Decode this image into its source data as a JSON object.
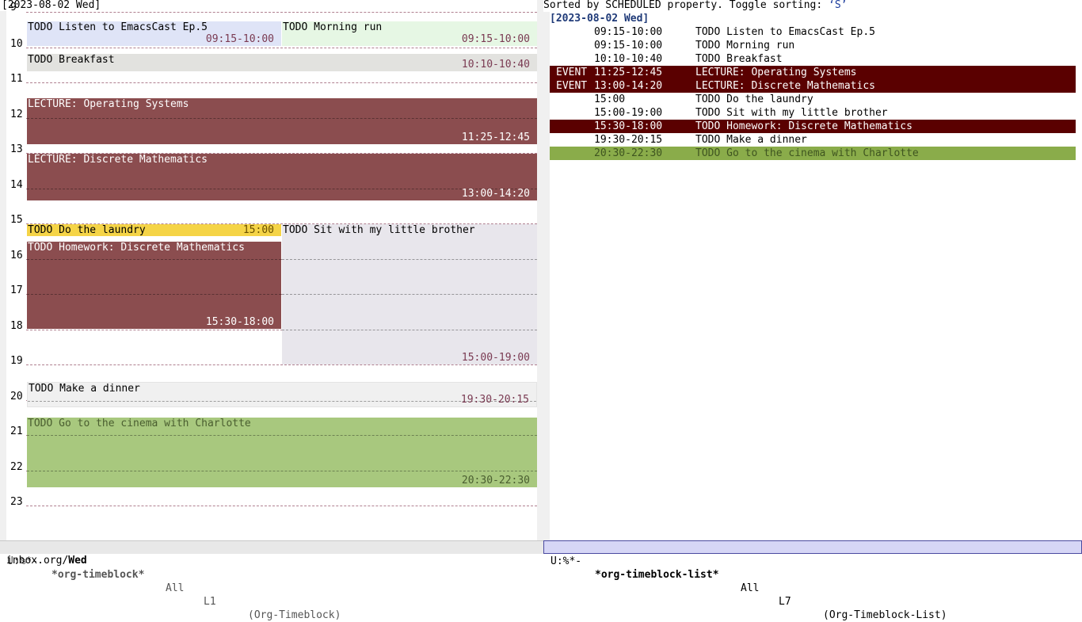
{
  "timeline": {
    "header_date": "[2023-08-02 Wed]",
    "hours": [
      "9",
      "10",
      "11",
      "12",
      "13",
      "14",
      "15",
      "16",
      "17",
      "18",
      "19",
      "20",
      "21",
      "22",
      "23"
    ],
    "blocks": [
      {
        "title": "TODO Listen to EmacsCast Ep.5",
        "time": "09:15-10:00"
      },
      {
        "title": "TODO Morning run",
        "time": "09:15-10:00"
      },
      {
        "title": "TODO Breakfast",
        "time": "10:10-10:40"
      },
      {
        "title": "LECTURE: Operating Systems",
        "time": "11:25-12:45"
      },
      {
        "title": "LECTURE: Discrete Mathematics",
        "time": "13:00-14:20"
      },
      {
        "title": "TODO Do the laundry",
        "time": "15:00"
      },
      {
        "title": "TODO Sit with my little brother",
        "time": "15:00-19:00"
      },
      {
        "title": "TODO Homework: Discrete Mathematics",
        "time": "15:30-18:00"
      },
      {
        "title": "TODO Make a dinner",
        "time": "19:30-20:15"
      },
      {
        "title": "TODO Go to the cinema with Charlotte",
        "time": "20:30-22:30"
      }
    ]
  },
  "list": {
    "header": "Sorted by SCHEDULED property. Toggle sorting: ",
    "sort_key": "‘S’",
    "date": "[2023-08-02 Wed]",
    "rows": [
      {
        "tag": "",
        "time": "09:15-10:00",
        "text": "TODO Listen to EmacsCast Ep.5"
      },
      {
        "tag": "",
        "time": "09:15-10:00",
        "text": "TODO Morning run"
      },
      {
        "tag": "",
        "time": "10:10-10:40",
        "text": "TODO Breakfast"
      },
      {
        "tag": "EVENT",
        "time": "11:25-12:45",
        "text": "LECTURE: Operating Systems"
      },
      {
        "tag": "EVENT",
        "time": "13:00-14:20",
        "text": "LECTURE: Discrete Mathematics"
      },
      {
        "tag": "",
        "time": "15:00",
        "text": "TODO Do the laundry"
      },
      {
        "tag": "",
        "time": "15:00-19:00",
        "text": "TODO Sit with my little brother"
      },
      {
        "tag": "",
        "time": "15:30-18:00",
        "text": "TODO Homework: Discrete Mathematics"
      },
      {
        "tag": "",
        "time": "19:30-20:15",
        "text": "TODO Make a dinner"
      },
      {
        "tag": "",
        "time": "20:30-22:30",
        "text": "TODO Go to the cinema with Charlotte"
      }
    ]
  },
  "modeline_left": {
    "status": "U:%*-",
    "buffer": "*org-timeblock*",
    "position": "All",
    "line": "L1",
    "mode": "(Org-Timeblock)"
  },
  "modeline_right": {
    "status": "U:%*-",
    "buffer": "*org-timeblock-list*",
    "position": "All",
    "line": "L7",
    "mode": "(Org-Timeblock-List)"
  },
  "minibuffer": {
    "path": "inbox.org/",
    "heading": "Wed"
  },
  "colors": {
    "lecture": "#8b4d4f",
    "laundry": "#f5d447",
    "cinema": "#a8c87e",
    "morning_run": "#e6f7e4",
    "emacscast": "#dfe4f7",
    "brother": "#e8e6ec",
    "event_row": "#5a0000",
    "cinema_row": "#8aac4a",
    "time_text": "#7a3a52"
  }
}
